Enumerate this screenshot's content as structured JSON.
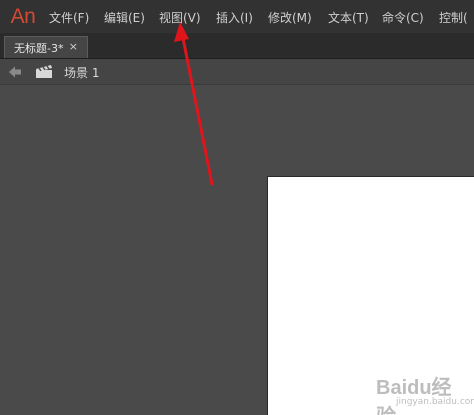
{
  "app": {
    "logo_text": "An",
    "logo_color": "#d24a36"
  },
  "menu": {
    "items": [
      {
        "label": "文件(F)"
      },
      {
        "label": "编辑(E)"
      },
      {
        "label": "视图(V)"
      },
      {
        "label": "插入(I)"
      },
      {
        "label": "修改(M)"
      },
      {
        "label": "文本(T)"
      },
      {
        "label": "命令(C)"
      },
      {
        "label": "控制("
      }
    ]
  },
  "tabs": [
    {
      "label": "无标题-3*",
      "close_glyph": "×"
    }
  ],
  "scene": {
    "label": "场景 1",
    "back_icon": "back-arrow-icon",
    "scene_icon": "clapperboard-icon"
  },
  "annotation": {
    "arrow_color": "#e0141b"
  },
  "watermark": {
    "main": "Baidu经验",
    "sub": "jingyan.baidu.com"
  }
}
